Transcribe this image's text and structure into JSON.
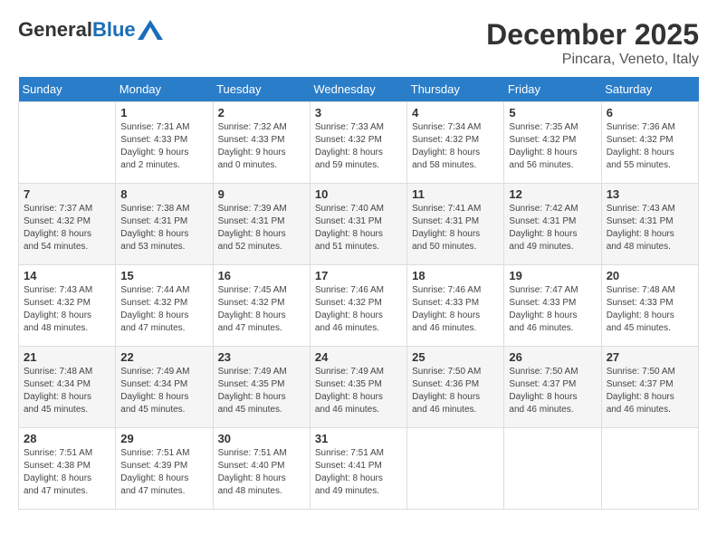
{
  "header": {
    "logo": {
      "general": "General",
      "blue": "Blue"
    },
    "month": "December 2025",
    "location": "Pincara, Veneto, Italy"
  },
  "days_of_week": [
    "Sunday",
    "Monday",
    "Tuesday",
    "Wednesday",
    "Thursday",
    "Friday",
    "Saturday"
  ],
  "weeks": [
    [
      {
        "day": "",
        "info": ""
      },
      {
        "day": "1",
        "info": "Sunrise: 7:31 AM\nSunset: 4:33 PM\nDaylight: 9 hours\nand 2 minutes."
      },
      {
        "day": "2",
        "info": "Sunrise: 7:32 AM\nSunset: 4:33 PM\nDaylight: 9 hours\nand 0 minutes."
      },
      {
        "day": "3",
        "info": "Sunrise: 7:33 AM\nSunset: 4:32 PM\nDaylight: 8 hours\nand 59 minutes."
      },
      {
        "day": "4",
        "info": "Sunrise: 7:34 AM\nSunset: 4:32 PM\nDaylight: 8 hours\nand 58 minutes."
      },
      {
        "day": "5",
        "info": "Sunrise: 7:35 AM\nSunset: 4:32 PM\nDaylight: 8 hours\nand 56 minutes."
      },
      {
        "day": "6",
        "info": "Sunrise: 7:36 AM\nSunset: 4:32 PM\nDaylight: 8 hours\nand 55 minutes."
      }
    ],
    [
      {
        "day": "7",
        "info": "Sunrise: 7:37 AM\nSunset: 4:32 PM\nDaylight: 8 hours\nand 54 minutes."
      },
      {
        "day": "8",
        "info": "Sunrise: 7:38 AM\nSunset: 4:31 PM\nDaylight: 8 hours\nand 53 minutes."
      },
      {
        "day": "9",
        "info": "Sunrise: 7:39 AM\nSunset: 4:31 PM\nDaylight: 8 hours\nand 52 minutes."
      },
      {
        "day": "10",
        "info": "Sunrise: 7:40 AM\nSunset: 4:31 PM\nDaylight: 8 hours\nand 51 minutes."
      },
      {
        "day": "11",
        "info": "Sunrise: 7:41 AM\nSunset: 4:31 PM\nDaylight: 8 hours\nand 50 minutes."
      },
      {
        "day": "12",
        "info": "Sunrise: 7:42 AM\nSunset: 4:31 PM\nDaylight: 8 hours\nand 49 minutes."
      },
      {
        "day": "13",
        "info": "Sunrise: 7:43 AM\nSunset: 4:31 PM\nDaylight: 8 hours\nand 48 minutes."
      }
    ],
    [
      {
        "day": "14",
        "info": "Sunrise: 7:43 AM\nSunset: 4:32 PM\nDaylight: 8 hours\nand 48 minutes."
      },
      {
        "day": "15",
        "info": "Sunrise: 7:44 AM\nSunset: 4:32 PM\nDaylight: 8 hours\nand 47 minutes."
      },
      {
        "day": "16",
        "info": "Sunrise: 7:45 AM\nSunset: 4:32 PM\nDaylight: 8 hours\nand 47 minutes."
      },
      {
        "day": "17",
        "info": "Sunrise: 7:46 AM\nSunset: 4:32 PM\nDaylight: 8 hours\nand 46 minutes."
      },
      {
        "day": "18",
        "info": "Sunrise: 7:46 AM\nSunset: 4:33 PM\nDaylight: 8 hours\nand 46 minutes."
      },
      {
        "day": "19",
        "info": "Sunrise: 7:47 AM\nSunset: 4:33 PM\nDaylight: 8 hours\nand 46 minutes."
      },
      {
        "day": "20",
        "info": "Sunrise: 7:48 AM\nSunset: 4:33 PM\nDaylight: 8 hours\nand 45 minutes."
      }
    ],
    [
      {
        "day": "21",
        "info": "Sunrise: 7:48 AM\nSunset: 4:34 PM\nDaylight: 8 hours\nand 45 minutes."
      },
      {
        "day": "22",
        "info": "Sunrise: 7:49 AM\nSunset: 4:34 PM\nDaylight: 8 hours\nand 45 minutes."
      },
      {
        "day": "23",
        "info": "Sunrise: 7:49 AM\nSunset: 4:35 PM\nDaylight: 8 hours\nand 45 minutes."
      },
      {
        "day": "24",
        "info": "Sunrise: 7:49 AM\nSunset: 4:35 PM\nDaylight: 8 hours\nand 46 minutes."
      },
      {
        "day": "25",
        "info": "Sunrise: 7:50 AM\nSunset: 4:36 PM\nDaylight: 8 hours\nand 46 minutes."
      },
      {
        "day": "26",
        "info": "Sunrise: 7:50 AM\nSunset: 4:37 PM\nDaylight: 8 hours\nand 46 minutes."
      },
      {
        "day": "27",
        "info": "Sunrise: 7:50 AM\nSunset: 4:37 PM\nDaylight: 8 hours\nand 46 minutes."
      }
    ],
    [
      {
        "day": "28",
        "info": "Sunrise: 7:51 AM\nSunset: 4:38 PM\nDaylight: 8 hours\nand 47 minutes."
      },
      {
        "day": "29",
        "info": "Sunrise: 7:51 AM\nSunset: 4:39 PM\nDaylight: 8 hours\nand 47 minutes."
      },
      {
        "day": "30",
        "info": "Sunrise: 7:51 AM\nSunset: 4:40 PM\nDaylight: 8 hours\nand 48 minutes."
      },
      {
        "day": "31",
        "info": "Sunrise: 7:51 AM\nSunset: 4:41 PM\nDaylight: 8 hours\nand 49 minutes."
      },
      {
        "day": "",
        "info": ""
      },
      {
        "day": "",
        "info": ""
      },
      {
        "day": "",
        "info": ""
      }
    ]
  ]
}
